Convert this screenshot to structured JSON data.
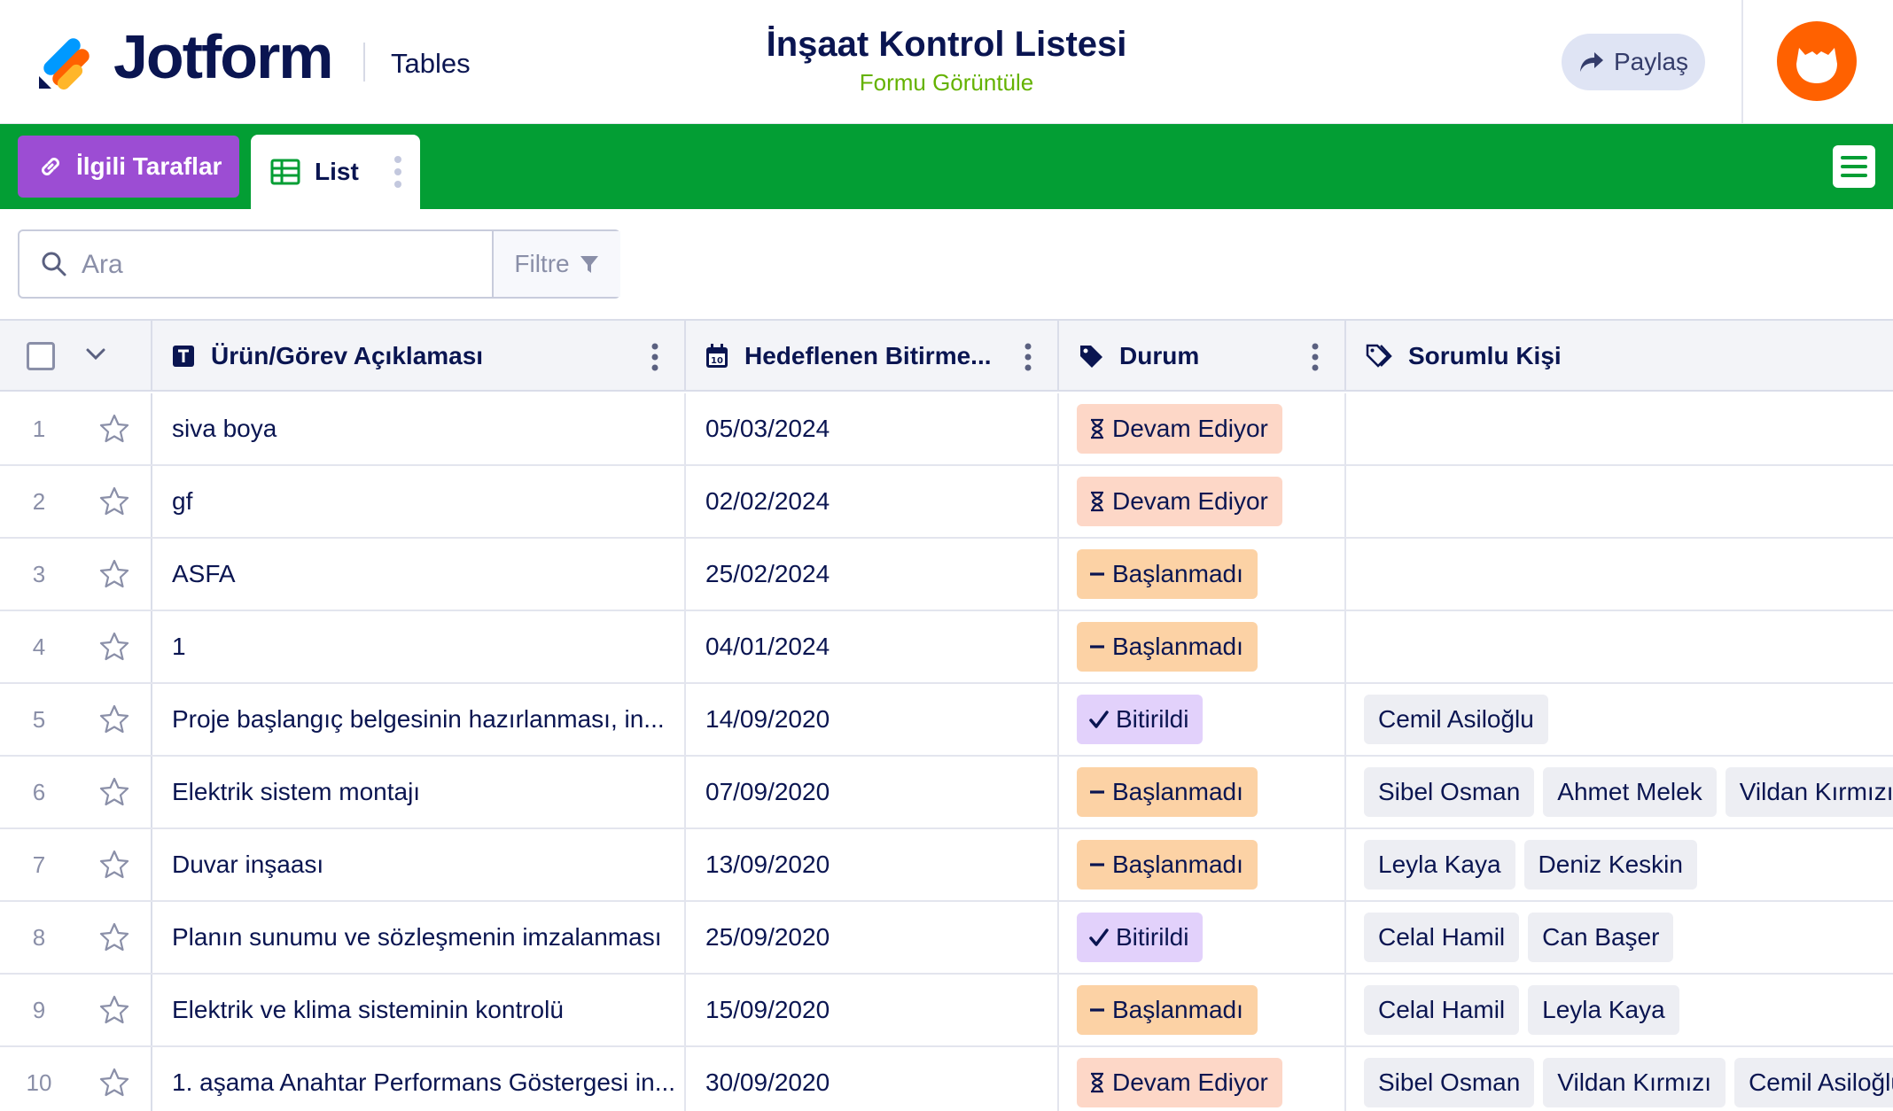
{
  "header": {
    "brand": "Jotform",
    "product": "Tables",
    "form_title": "İnşaat Kontrol Listesi",
    "form_link": "Formu Görüntüle",
    "share_label": "Paylaş"
  },
  "tabs": {
    "related_label": "İlgili Taraflar",
    "list_label": "List"
  },
  "search": {
    "placeholder": "Ara",
    "filter_label": "Filtre"
  },
  "columns": [
    {
      "label": "Ürün/Görev Açıklaması",
      "icon": "text-type-icon"
    },
    {
      "label": "Hedeflenen Bitirme...",
      "icon": "calendar-icon"
    },
    {
      "label": "Durum",
      "icon": "tag-icon"
    },
    {
      "label": "Sorumlu Kişi",
      "icon": "tags-icon"
    }
  ],
  "rows": [
    {
      "num": "1",
      "desc": "siva boya",
      "date": "05/03/2024",
      "status": "Devam Ediyor",
      "status_kind": "devam",
      "people": []
    },
    {
      "num": "2",
      "desc": "gf",
      "date": "02/02/2024",
      "status": "Devam Ediyor",
      "status_kind": "devam",
      "people": []
    },
    {
      "num": "3",
      "desc": "ASFA",
      "date": "25/02/2024",
      "status": "Başlanmadı",
      "status_kind": "bas",
      "people": []
    },
    {
      "num": "4",
      "desc": "1",
      "date": "04/01/2024",
      "status": "Başlanmadı",
      "status_kind": "bas",
      "people": []
    },
    {
      "num": "5",
      "desc": "Proje başlangıç belgesinin hazırlanması, in...",
      "date": "14/09/2020",
      "status": "Bitirildi",
      "status_kind": "bitir",
      "people": [
        "Cemil Asiloğlu"
      ]
    },
    {
      "num": "6",
      "desc": "Elektrik sistem montajı",
      "date": "07/09/2020",
      "status": "Başlanmadı",
      "status_kind": "bas",
      "people": [
        "Sibel Osman",
        "Ahmet Melek",
        "Vildan Kırmızı"
      ]
    },
    {
      "num": "7",
      "desc": "Duvar inşaası",
      "date": "13/09/2020",
      "status": "Başlanmadı",
      "status_kind": "bas",
      "people": [
        "Leyla Kaya",
        "Deniz Keskin"
      ]
    },
    {
      "num": "8",
      "desc": "Planın sunumu ve sözleşmenin imzalanması",
      "date": "25/09/2020",
      "status": "Bitirildi",
      "status_kind": "bitir",
      "people": [
        "Celal Hamil",
        "Can Başer"
      ]
    },
    {
      "num": "9",
      "desc": "Elektrik ve klima sisteminin kontrolü",
      "date": "15/09/2020",
      "status": "Başlanmadı",
      "status_kind": "bas",
      "people": [
        "Celal Hamil",
        "Leyla Kaya"
      ]
    },
    {
      "num": "10",
      "desc": "1. aşama Anahtar Performans Göstergesi in...",
      "date": "30/09/2020",
      "status": "Devam Ediyor",
      "status_kind": "devam",
      "people": [
        "Sibel Osman",
        "Vildan Kırmızı",
        "Cemil Asiloğlu"
      ]
    }
  ],
  "status_icons": {
    "devam": "hourglass-icon",
    "bas": "dash-icon",
    "bitir": "checkmark-icon"
  },
  "colors": {
    "brand_green": "#039e34",
    "related_purple": "#9c4dd3",
    "avatar_orange": "#ff6100",
    "link_green": "#64b200"
  }
}
